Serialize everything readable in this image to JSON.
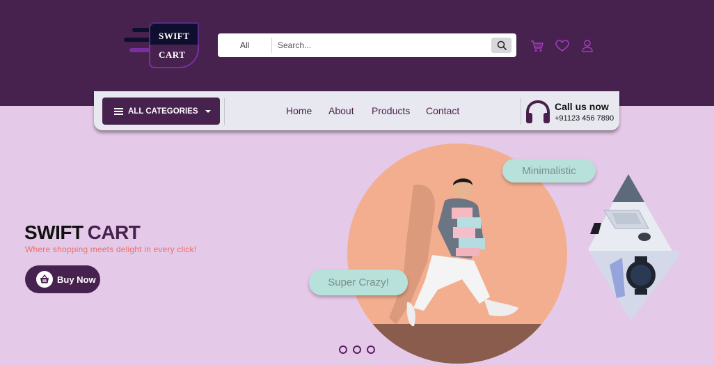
{
  "header": {
    "logo": {
      "line1": "SWIFT",
      "line2": "CART"
    },
    "search": {
      "category": "All",
      "placeholder": "Search..."
    },
    "icons": [
      "cart-icon",
      "heart-icon",
      "user-icon"
    ]
  },
  "nav": {
    "categories_label": "ALL CATEGORIES",
    "links": [
      "Home",
      "About",
      "Products",
      "Contact"
    ],
    "call": {
      "title": "Call us now",
      "phone": "+91123 456 7890"
    }
  },
  "hero": {
    "title_part1": "SWIFT",
    "title_part2": "CART",
    "subtitle": "Where shopping meets delight in every click!",
    "button_label": "Buy Now",
    "tags": [
      "Minimalistic",
      "Super Crazy!"
    ],
    "carousel_dots": 3
  },
  "colors": {
    "brand": "#48224e",
    "background": "#e5c9e8",
    "accent_peach": "#f3ae8f",
    "tag_mint": "#b7e1da",
    "subtitle_coral": "#e8706a",
    "icon_purple": "#a13cc0"
  }
}
